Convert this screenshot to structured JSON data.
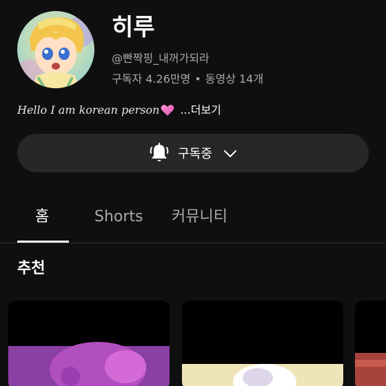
{
  "channel": {
    "name": "히루",
    "handle": "@빤짝핑_내꺼가되라",
    "subscribers": "구독자 4.26만명",
    "separator": "•",
    "videos": "동영상 14개"
  },
  "description": {
    "text": "Hello I am korean person",
    "emoji": "pink-heart-icon",
    "more_label": "...더보기"
  },
  "subscribe": {
    "label": "구독중",
    "icon": "bell-ringing-icon"
  },
  "tabs": [
    {
      "label": "홈",
      "active": true
    },
    {
      "label": "Shorts",
      "active": false
    },
    {
      "label": "커뮤니티",
      "active": false
    }
  ],
  "section": {
    "title": "추천"
  },
  "colors": {
    "background": "#0f0f0f",
    "button": "#272727",
    "secondary_text": "#aaaaaa"
  }
}
